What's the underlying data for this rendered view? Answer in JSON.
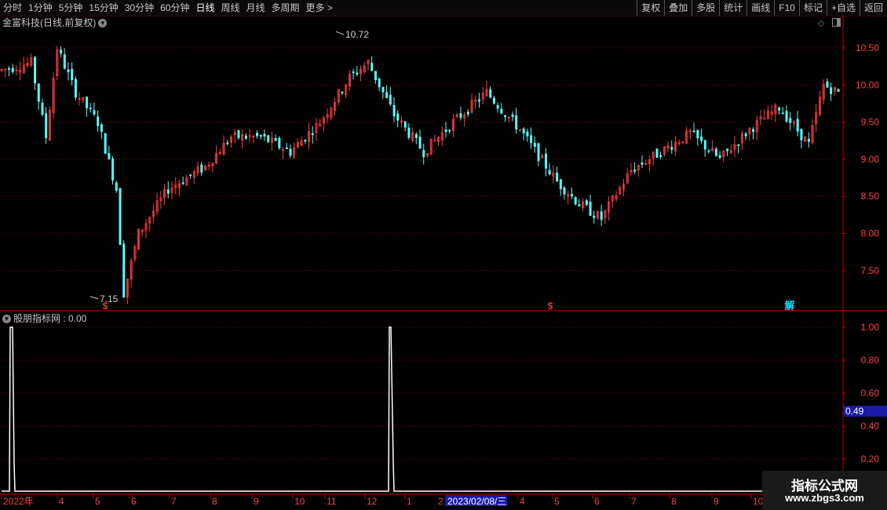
{
  "toolbar": {
    "periods": [
      {
        "label": "分时",
        "active": false
      },
      {
        "label": "1分钟",
        "active": false
      },
      {
        "label": "5分钟",
        "active": false
      },
      {
        "label": "15分钟",
        "active": false
      },
      {
        "label": "30分钟",
        "active": false
      },
      {
        "label": "60分钟",
        "active": false
      },
      {
        "label": "日线",
        "active": true
      },
      {
        "label": "周线",
        "active": false
      },
      {
        "label": "月线",
        "active": false
      },
      {
        "label": "多周期",
        "active": false
      },
      {
        "label": "更多 >",
        "active": false
      }
    ],
    "actions": [
      "复权",
      "叠加",
      "多股",
      "统计",
      "画线",
      "F10",
      "标记",
      "+自选",
      "返回"
    ]
  },
  "main_chart": {
    "title": "金富科技(日线,前复权)",
    "price_axis": [
      10.5,
      10.0,
      9.5,
      9.0,
      8.5,
      8.0,
      7.5
    ],
    "high_label": "10.72",
    "low_label": "7.15",
    "markers": [
      {
        "text": "$",
        "color": "#ff3030"
      },
      {
        "text": "$",
        "color": "#ff3030"
      },
      {
        "text": "解",
        "color": "#00e5ff"
      }
    ]
  },
  "sub_chart": {
    "title": "股朋指标网 : 0.00",
    "axis": [
      "1.00",
      "0.80",
      "0.60",
      "0.40",
      "0.20"
    ],
    "current_value": "0.49"
  },
  "date_axis": {
    "ticks": [
      "2022年",
      "4",
      "5",
      "6",
      "7",
      "8",
      "9",
      "10",
      "11",
      "12",
      "1",
      "2",
      "3",
      "4",
      "5",
      "6",
      "7",
      "8",
      "9",
      "10"
    ],
    "cursor_label": "2023/02/08/三"
  },
  "watermark": {
    "title": "指标公式网",
    "url": "www.zbgs3.com"
  },
  "colors": {
    "up": "#ff3c3c",
    "down": "#54ffff",
    "grid": "#8a0000",
    "axis_line": "#c00000"
  }
}
